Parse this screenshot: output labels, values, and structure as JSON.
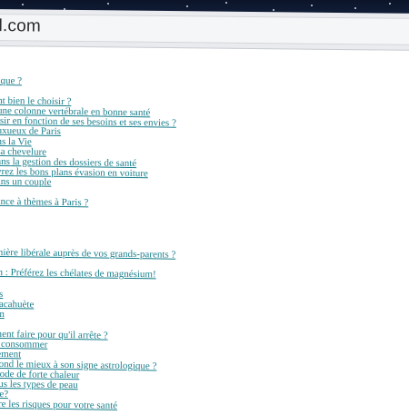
{
  "browser": {
    "url": "el.com"
  },
  "links": [
    "ique ?",
    "nt bien le choisir ?",
    " une colonne vertébrale en bonne santé",
    "isir en fonction de ses besoins et ses envies ?",
    "uxueux de Paris",
    "ns la Vie",
    "sa chevelure",
    "ans la gestion des dossiers de santé",
    "vrez les bons plans évasion en voiture",
    "ans un couple",
    "ance à thèmes à Paris ?",
    "e",
    "mière libérale auprès de vos grands-parents ?",
    "m : Préférez les chélates de magnésium!",
    "es",
    "cacahuète",
    "on",
    "ment faire pour qu'il arrête ?",
    "à consommer",
    "tement",
    "pond le mieux à son signe astrologique ?",
    "riode de forte chaleur",
    "ous les types de peau",
    "ire?",
    "dre les risques pour votre santé"
  ]
}
